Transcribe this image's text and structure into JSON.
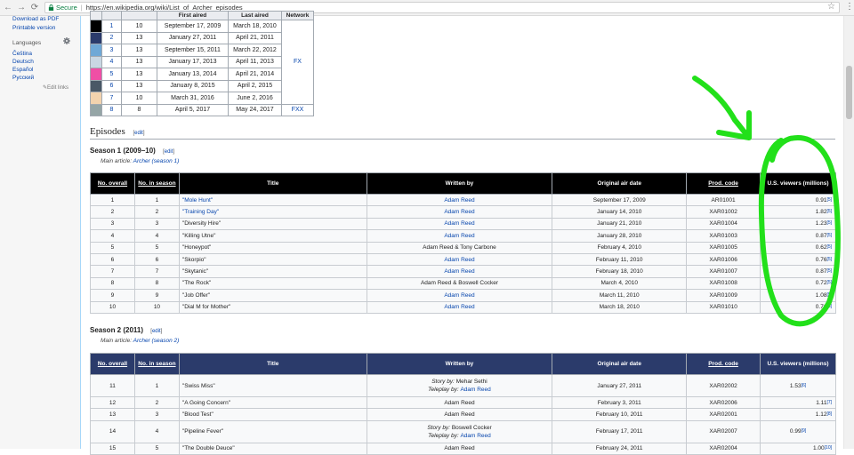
{
  "browser": {
    "secure_label": "Secure",
    "url": "https://en.wikipedia.org/wiki/List_of_Archer_episodes"
  },
  "sidebar": {
    "links_top": [
      "Download as PDF",
      "Printable version"
    ],
    "languages_heading": "Languages",
    "languages": [
      "Čeština",
      "Deutsch",
      "Español",
      "Русский"
    ],
    "edit_links": "Edit links"
  },
  "overview": {
    "headers": [
      "",
      "",
      "First aired",
      "Last aired",
      "Network"
    ],
    "rows": [
      {
        "color": "#000000",
        "season": "1",
        "episodes": "10",
        "first": "September 17, 2009",
        "last": "March 18, 2010"
      },
      {
        "color": "#2b3b6b",
        "season": "2",
        "episodes": "13",
        "first": "January 27, 2011",
        "last": "April 21, 2011"
      },
      {
        "color": "#6fa8d6",
        "season": "3",
        "episodes": "13",
        "first": "September 15, 2011",
        "last": "March 22, 2012"
      },
      {
        "color": "#c9d7e3",
        "season": "4",
        "episodes": "13",
        "first": "January 17, 2013",
        "last": "April 11, 2013"
      },
      {
        "color": "#ef4fa5",
        "season": "5",
        "episodes": "13",
        "first": "January 13, 2014",
        "last": "April 21, 2014"
      },
      {
        "color": "#4a5866",
        "season": "6",
        "episodes": "13",
        "first": "January 8, 2015",
        "last": "April 2, 2015"
      },
      {
        "color": "#f3d3ae",
        "season": "7",
        "episodes": "10",
        "first": "March 31, 2016",
        "last": "June 2, 2016"
      },
      {
        "color": "#95a5a6",
        "season": "8",
        "episodes": "8",
        "first": "April 5, 2017",
        "last": "May 24, 2017"
      }
    ],
    "network_fx": "FX",
    "network_fxx": "FXX"
  },
  "episodes_heading": "Episodes",
  "edit_label": "edit",
  "main_article_prefix": "Main article: ",
  "columns": {
    "no_overall": "No. overall",
    "no_season": "No. in season",
    "title": "Title",
    "written_by": "Written by",
    "air_date": "Original air date",
    "prod_code": "Prod. code",
    "viewers": "U.S. viewers (millions)"
  },
  "season1": {
    "heading": "Season 1 (2009–10)",
    "main_article": "Archer (season 1)",
    "rows": [
      {
        "no": "1",
        "ns": "1",
        "title": "\"Mole Hunt\"",
        "writer": "Adam Reed",
        "date": "September 17, 2009",
        "code": "AR01001",
        "viewers": "0.91",
        "ref": "[5]"
      },
      {
        "no": "2",
        "ns": "2",
        "title": "\"Training Day\"",
        "writer": "Adam Reed",
        "date": "January 14, 2010",
        "code": "XAR01002",
        "viewers": "1.82",
        "ref": "[5]"
      },
      {
        "no": "3",
        "ns": "3",
        "title": "\"Diversity Hire\"",
        "writer": "Adam Reed",
        "date": "January 21, 2010",
        "code": "XAR01004",
        "viewers": "1.23",
        "ref": "[5]"
      },
      {
        "no": "4",
        "ns": "4",
        "title": "\"Killing Utne\"",
        "writer": "Adam Reed",
        "date": "January 28, 2010",
        "code": "XAR01003",
        "viewers": "0.87",
        "ref": "[5]"
      },
      {
        "no": "5",
        "ns": "5",
        "title": "\"Honeypot\"",
        "writer": "Adam Reed & Tony Carbone",
        "date": "February 4, 2010",
        "code": "XAR01005",
        "viewers": "0.62",
        "ref": "[5]"
      },
      {
        "no": "6",
        "ns": "6",
        "title": "\"Skorpio\"",
        "writer": "Adam Reed",
        "date": "February 11, 2010",
        "code": "XAR01006",
        "viewers": "0.76",
        "ref": "[5]"
      },
      {
        "no": "7",
        "ns": "7",
        "title": "\"Skytanic\"",
        "writer": "Adam Reed",
        "date": "February 18, 2010",
        "code": "XAR01007",
        "viewers": "0.87",
        "ref": "[5]"
      },
      {
        "no": "8",
        "ns": "8",
        "title": "\"The Rock\"",
        "writer": "Adam Reed & Boswell Cocker",
        "date": "March 4, 2010",
        "code": "XAR01008",
        "viewers": "0.72",
        "ref": "[5]"
      },
      {
        "no": "9",
        "ns": "9",
        "title": "\"Job Offer\"",
        "writer": "Adam Reed",
        "date": "March 11, 2010",
        "code": "XAR01009",
        "viewers": "1.08",
        "ref": "[5]"
      },
      {
        "no": "10",
        "ns": "10",
        "title": "\"Dial M for Mother\"",
        "writer": "Adam Reed",
        "date": "March 18, 2010",
        "code": "XAR01010",
        "viewers": "0.76",
        "ref": "[5]"
      }
    ]
  },
  "season2": {
    "heading": "Season 2 (2011)",
    "main_article": "Archer (season 2)",
    "rows": [
      {
        "no": "11",
        "ns": "1",
        "title": "\"Swiss Miss\"",
        "story_label": "Story by: ",
        "story": "Mehar Sethi",
        "tele_label": "Teleplay by: ",
        "tele": "Adam Reed",
        "date": "January 27, 2011",
        "code": "XAR02002",
        "viewers": "1.53",
        "ref": "[6]"
      },
      {
        "no": "12",
        "ns": "2",
        "title": "\"A Going Concern\"",
        "writer": "Adam Reed",
        "date": "February 3, 2011",
        "code": "XAR02006",
        "viewers": "1.11",
        "ref": "[7]"
      },
      {
        "no": "13",
        "ns": "3",
        "title": "\"Blood Test\"",
        "writer": "Adam Reed",
        "date": "February 10, 2011",
        "code": "XAR02001",
        "viewers": "1.12",
        "ref": "[8]"
      },
      {
        "no": "14",
        "ns": "4",
        "title": "\"Pipeline Fever\"",
        "story_label": "Story by: ",
        "story": "Boswell Cocker",
        "tele_label": "Teleplay by: ",
        "tele": "Adam Reed",
        "date": "February 17, 2011",
        "code": "XAR02007",
        "viewers": "0.99",
        "ref": "[9]"
      },
      {
        "no": "15",
        "ns": "5",
        "title": "\"The Double Deuce\"",
        "writer": "Adam Reed",
        "date": "February 24, 2011",
        "code": "XAR02004",
        "viewers": "1.00",
        "ref": "[10]"
      }
    ]
  },
  "annotation": {
    "color": "#22e01a"
  }
}
